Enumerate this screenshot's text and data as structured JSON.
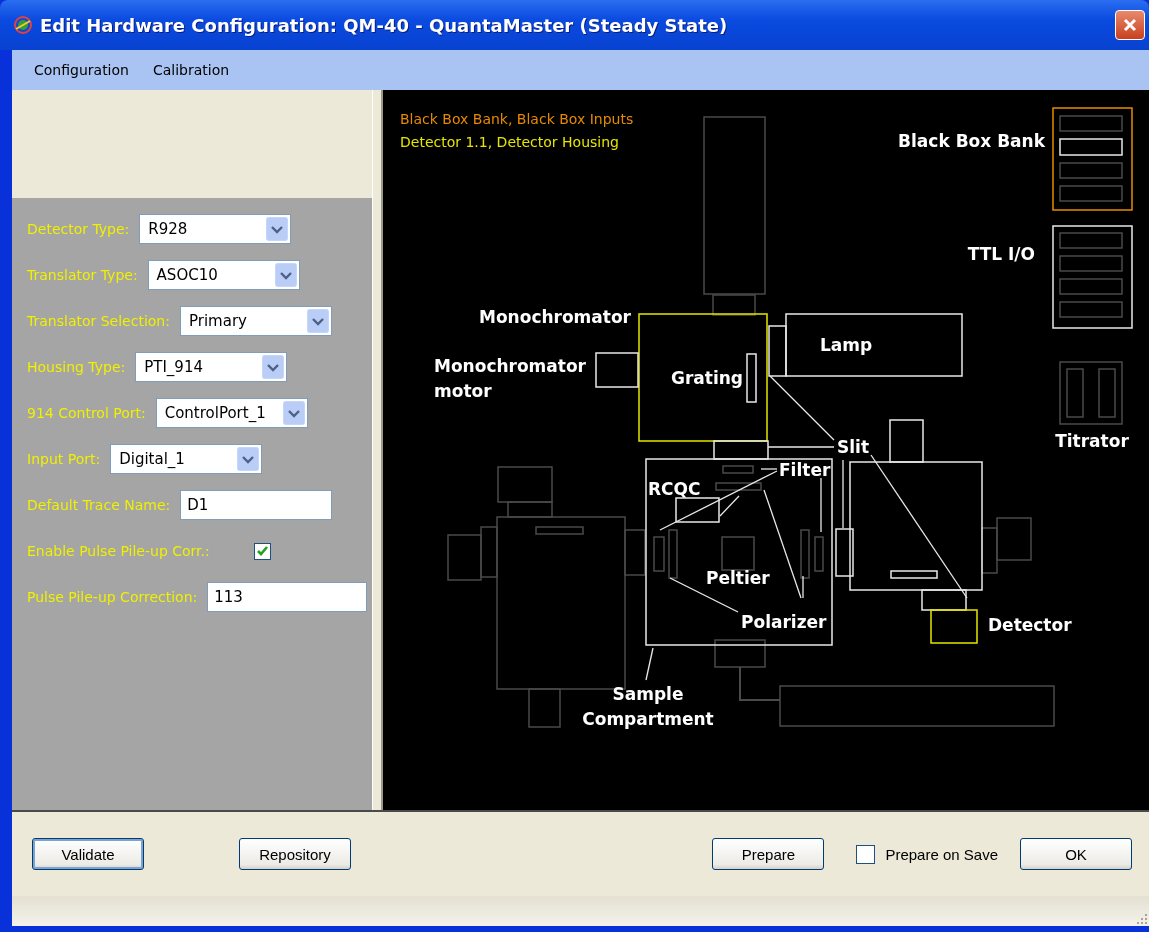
{
  "window": {
    "title": "Edit Hardware Configuration: QM-40 - QuantaMaster (Steady State)"
  },
  "menu": [
    "Configuration",
    "Calibration"
  ],
  "fields": [
    {
      "kind": "dropdown",
      "label": "Detector Type:",
      "value": "R928"
    },
    {
      "kind": "dropdown",
      "label": "Translator Type:",
      "value": "ASOC10"
    },
    {
      "kind": "dropdown",
      "label": "Translator Selection:",
      "value": "Primary"
    },
    {
      "kind": "dropdown",
      "label": "Housing Type:",
      "value": "PTI_914"
    },
    {
      "kind": "dropdown",
      "label": "914 Control Port:",
      "value": "ControlPort_1"
    },
    {
      "kind": "dropdown",
      "label": "Input Port:",
      "value": "Digital_1"
    },
    {
      "kind": "text",
      "label": "Default Trace Name:",
      "value": "D1"
    },
    {
      "kind": "checkbox",
      "label": "Enable Pulse Pile-up Corr.:",
      "checked": true
    },
    {
      "kind": "text",
      "label": "Pulse Pile-up Correction:",
      "value": "113"
    }
  ],
  "diagram": {
    "selection": [
      {
        "text": "Black Box Bank, Black Box Inputs",
        "color": "#e88a00"
      },
      {
        "text": "Detector 1.1, Detector Housing",
        "color": "#e6e600"
      }
    ],
    "labels": [
      {
        "lines": [
          "Black Box Bank"
        ]
      },
      {
        "lines": [
          "TTL I/O"
        ]
      },
      {
        "lines": [
          "Monochromator"
        ]
      },
      {
        "lines": [
          "Lamp"
        ]
      },
      {
        "lines": [
          "Monochromator",
          "motor"
        ]
      },
      {
        "lines": [
          "Grating"
        ]
      },
      {
        "lines": [
          "Titrator"
        ]
      },
      {
        "lines": [
          "Slit"
        ]
      },
      {
        "lines": [
          "Filter"
        ]
      },
      {
        "lines": [
          "RCQC"
        ]
      },
      {
        "lines": [
          "Peltier"
        ]
      },
      {
        "lines": [
          "Polarizer"
        ]
      },
      {
        "lines": [
          "Detector"
        ]
      },
      {
        "lines": [
          "Sample",
          "Compartment"
        ]
      }
    ]
  },
  "left_buttons": [
    {
      "label": "Validate",
      "focused": true
    },
    {
      "label": "Repository",
      "focused": false
    }
  ],
  "prepare_button": {
    "label": "Prepare"
  },
  "prepare_on_save": {
    "label": "Prepare on Save",
    "checked": false
  },
  "ok_button": {
    "label": "OK"
  }
}
